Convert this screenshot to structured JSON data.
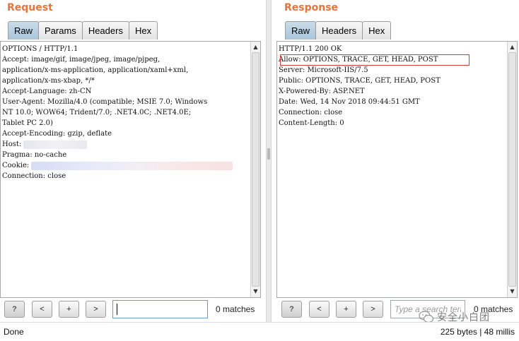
{
  "request": {
    "title": "Request",
    "tabs": [
      {
        "label": "Raw",
        "active": true
      },
      {
        "label": "Params",
        "active": false
      },
      {
        "label": "Headers",
        "active": false
      },
      {
        "label": "Hex",
        "active": false
      }
    ],
    "lines": [
      "OPTIONS / HTTP/1.1",
      "Accept: image/gif, image/jpeg, image/pjpeg,",
      "application/x-ms-application, application/xaml+xml,",
      "application/x-ms-xbap, */*",
      "Accept-Language: zh-CN",
      "User-Agent: Mozilla/4.0 (compatible; MSIE 7.0; Windows",
      "NT 10.0; WOW64; Trident/7.0; .NET4.0C; .NET4.0E;",
      "Tablet PC 2.0)",
      "Accept-Encoding: gzip, deflate",
      "Host: ",
      "Pragma: no-cache",
      "Cookie: ",
      "Connection: close"
    ],
    "search": {
      "value": "",
      "matches": "0 matches"
    },
    "buttons": {
      "help": "?",
      "prev": "<",
      "add": "+",
      "next": ">"
    }
  },
  "response": {
    "title": "Response",
    "tabs": [
      {
        "label": "Raw",
        "active": true
      },
      {
        "label": "Headers",
        "active": false
      },
      {
        "label": "Hex",
        "active": false
      }
    ],
    "lines": [
      "HTTP/1.1 200 OK",
      "Allow: OPTIONS, TRACE, GET, HEAD, POST",
      "Server: Microsoft-IIS/7.5",
      "Public: OPTIONS, TRACE, GET, HEAD, POST",
      "X-Powered-By: ASP.NET",
      "Date: Wed, 14 Nov 2018 09:44:51 GMT",
      "Connection: close",
      "Content-Length: 0"
    ],
    "search": {
      "placeholder": "Type a search term",
      "matches": "0 matches"
    },
    "buttons": {
      "help": "?",
      "prev": "<",
      "add": "+",
      "next": ">"
    }
  },
  "status": {
    "text": "Done",
    "stats": "225 bytes | 48 millis"
  },
  "watermark": {
    "text": "安全小白团"
  },
  "colors": {
    "title_accent": "#e8733c",
    "highlight_box": "#d23b3b",
    "active_tab": "#b8cfe0"
  }
}
